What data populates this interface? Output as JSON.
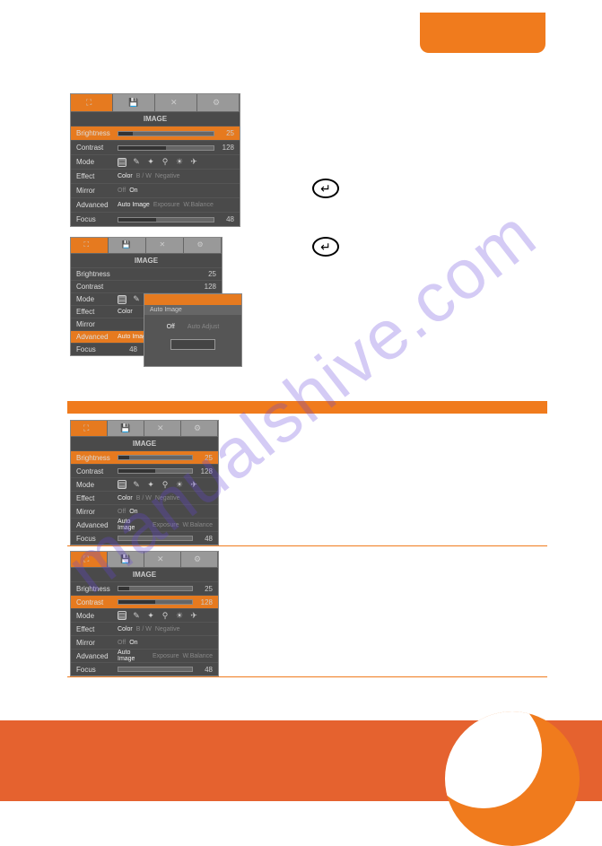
{
  "watermark": "manualshive.com",
  "tabs": {
    "image": "image-tab-icon",
    "save": "save-tab-icon",
    "tools": "tools-tab-icon",
    "settings": "settings-tab-icon"
  },
  "menu_title": "IMAGE",
  "rows": {
    "brightness": {
      "label": "Brightness",
      "value": "25"
    },
    "contrast": {
      "label": "Contrast",
      "value": "128"
    },
    "mode": {
      "label": "Mode"
    },
    "effect": {
      "label": "Effect",
      "opt1": "Color",
      "opt2": "B / W",
      "opt3": "Negative"
    },
    "mirror": {
      "label": "Mirror",
      "on": "On",
      "off": "Off"
    },
    "advanced": {
      "label": "Advanced",
      "opt1": "Auto Image",
      "opt2": "Exposure",
      "opt3": "W.Balance"
    },
    "focus": {
      "label": "Focus",
      "value": "48"
    }
  },
  "dialog": {
    "title": "Auto Image",
    "off": "Off",
    "auto": "Auto Adjust"
  },
  "enter_symbol": "↵"
}
